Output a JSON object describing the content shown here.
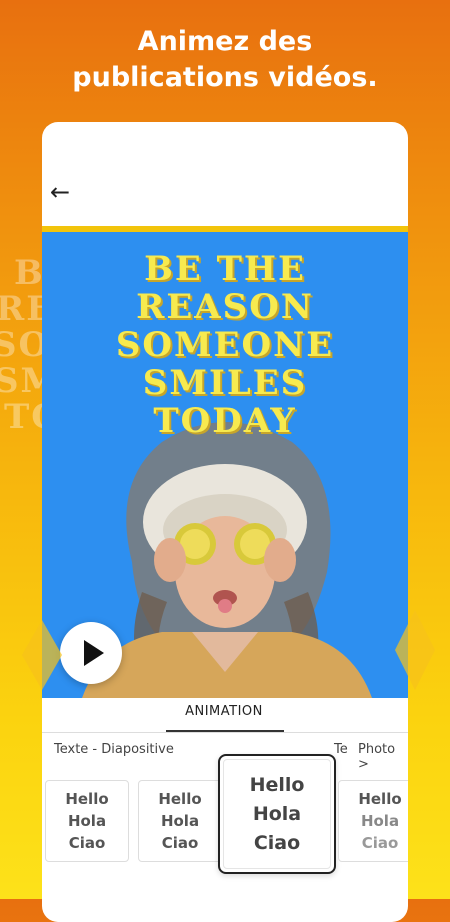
{
  "headline": "Animez des publications vidéos.",
  "quote_lines": [
    "BE THE",
    "REASON",
    "SOMEONE",
    "SMILES",
    "TODAY"
  ],
  "tab_label": "ANIMATION",
  "categories": {
    "left": "Texte - Diapositive",
    "mid": "Te",
    "right": "Photo >"
  },
  "cards": [
    {
      "lines": [
        "Hello",
        "Hola",
        "Ciao"
      ]
    },
    {
      "lines": [
        "Hello",
        "Hola",
        "Ciao"
      ]
    },
    {
      "lines": [
        "Hello",
        "Hola",
        "Ciao"
      ]
    },
    {
      "lines": [
        "Hello",
        "Hola",
        "Ciao"
      ]
    }
  ],
  "colors": {
    "accent": "#f2c40b",
    "post_bg": "#2d8ff0",
    "quote": "#f7ea4f"
  },
  "icons": {
    "back": "back-arrow-icon",
    "play": "play-icon"
  }
}
